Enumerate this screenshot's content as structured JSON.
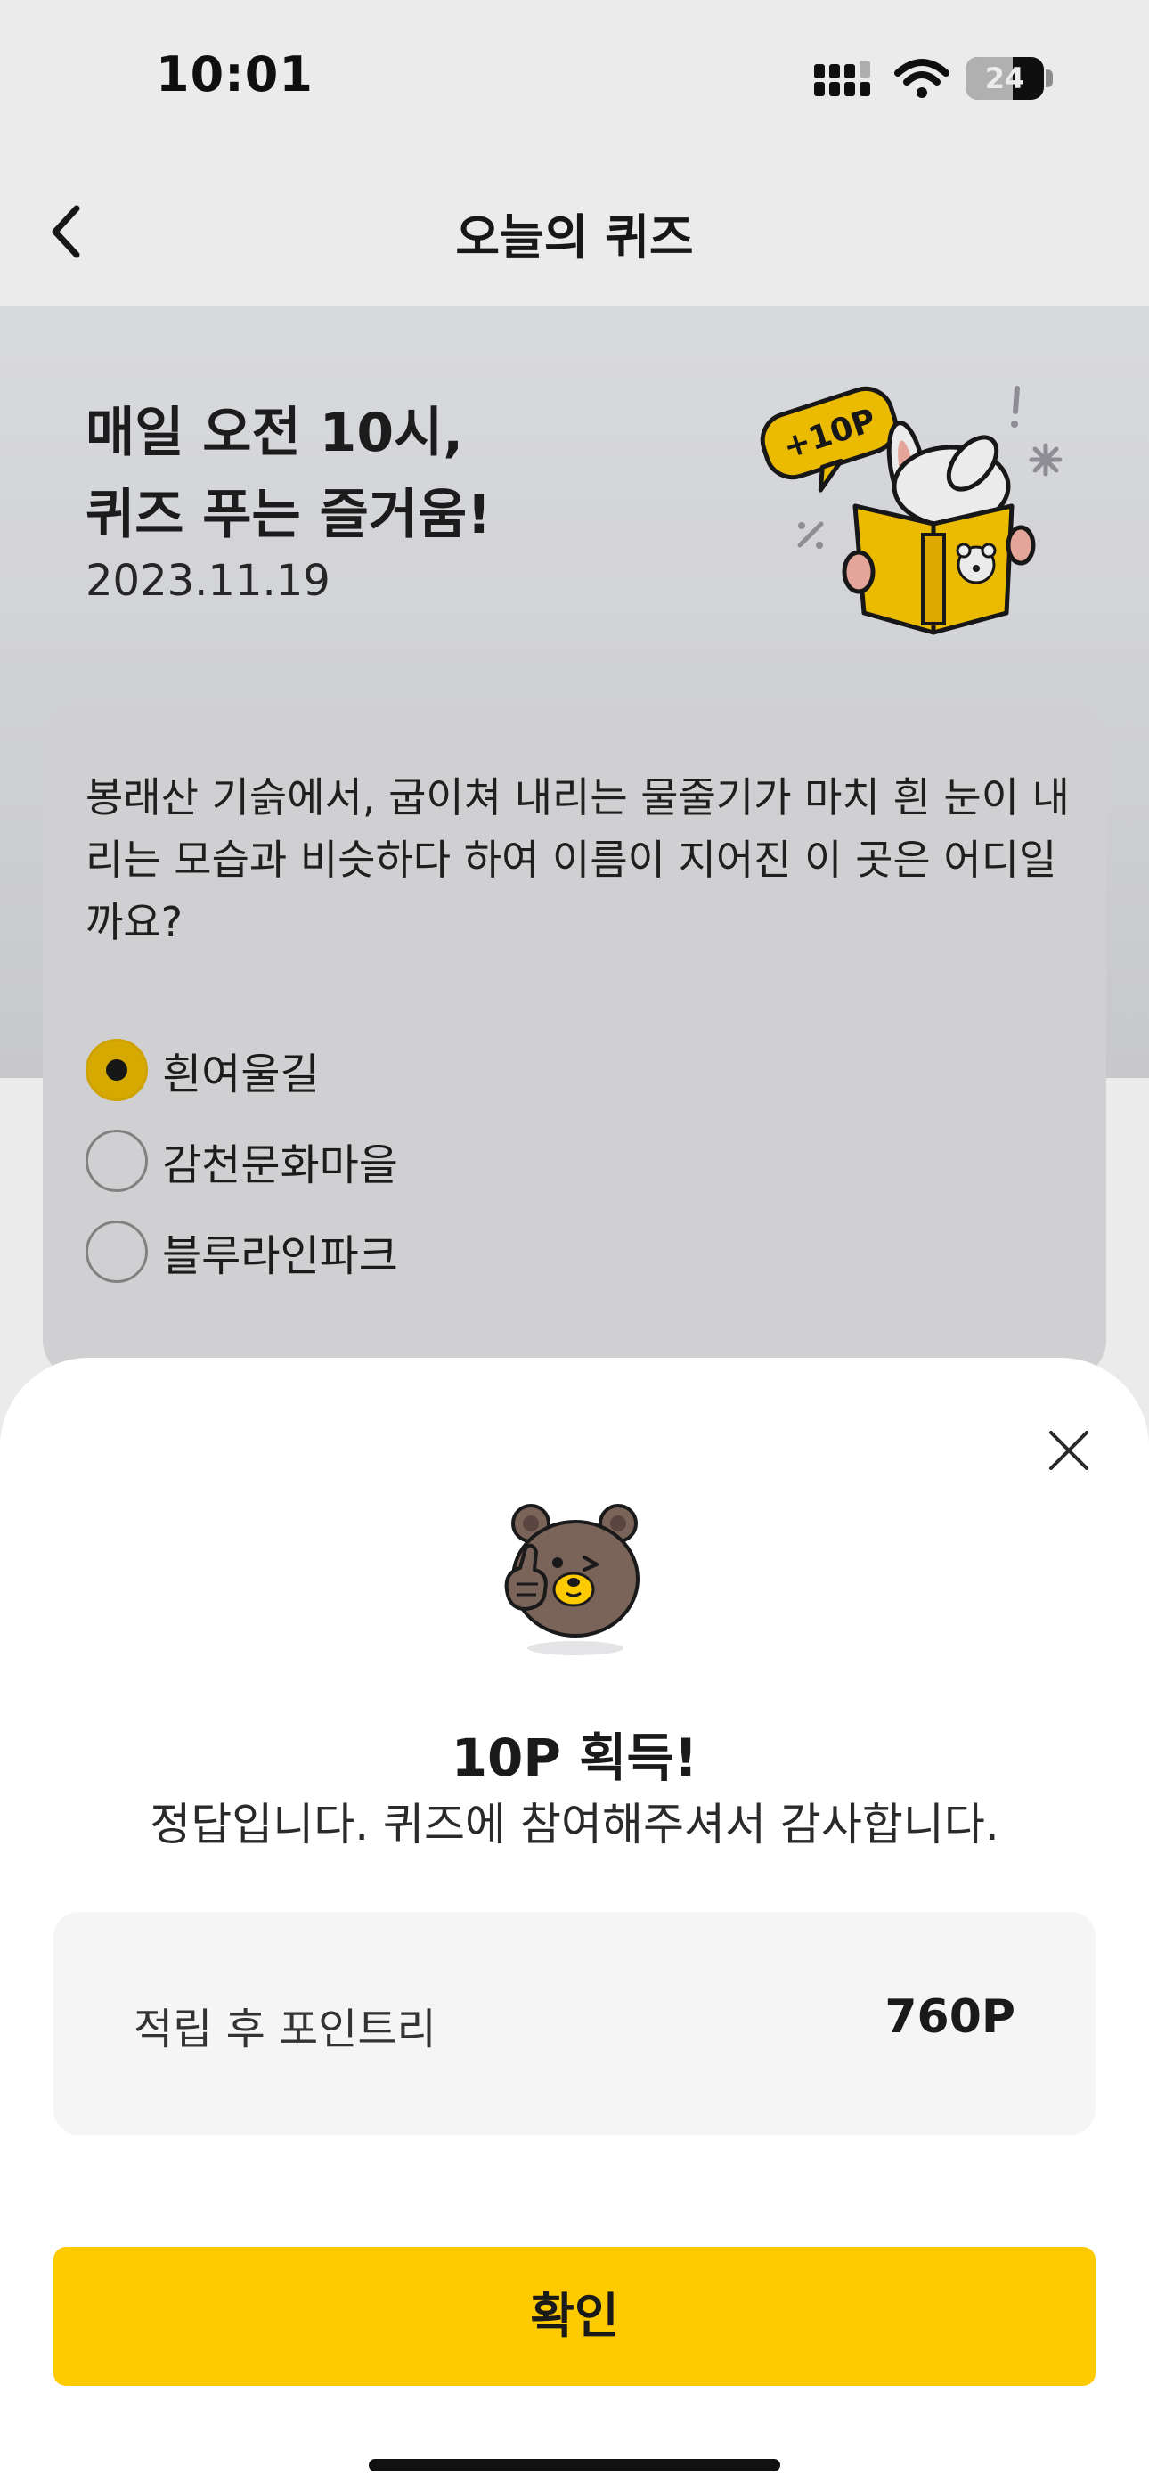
{
  "status_bar": {
    "time": "10:01",
    "battery": "24"
  },
  "header": {
    "title": "오늘의 퀴즈"
  },
  "hero": {
    "title": "매일 오전 10시,\n퀴즈 푸는 즐거움!",
    "date": "2023.11.19",
    "badge": "+10P"
  },
  "quiz": {
    "question": "봉래산 기슭에서, 굽이쳐 내리는 물줄기가 마치 흰 눈이 내리는 모습과 비슷하다 하여 이름이 지어진 이 곳은 어디일까요?",
    "options": [
      {
        "label": "흰여울길",
        "selected": true
      },
      {
        "label": "감천문화마을",
        "selected": false
      },
      {
        "label": "블루라인파크",
        "selected": false
      }
    ]
  },
  "result_sheet": {
    "title": "10P 획득!",
    "message": "정답입니다. 퀴즈에 참여해주셔서 감사합니다.",
    "points_label": "적립 후 포인트리",
    "points_value": "760P",
    "confirm_label": "확인"
  },
  "colors": {
    "accent": "#fecb00",
    "selected_radio": "#e8b800"
  }
}
